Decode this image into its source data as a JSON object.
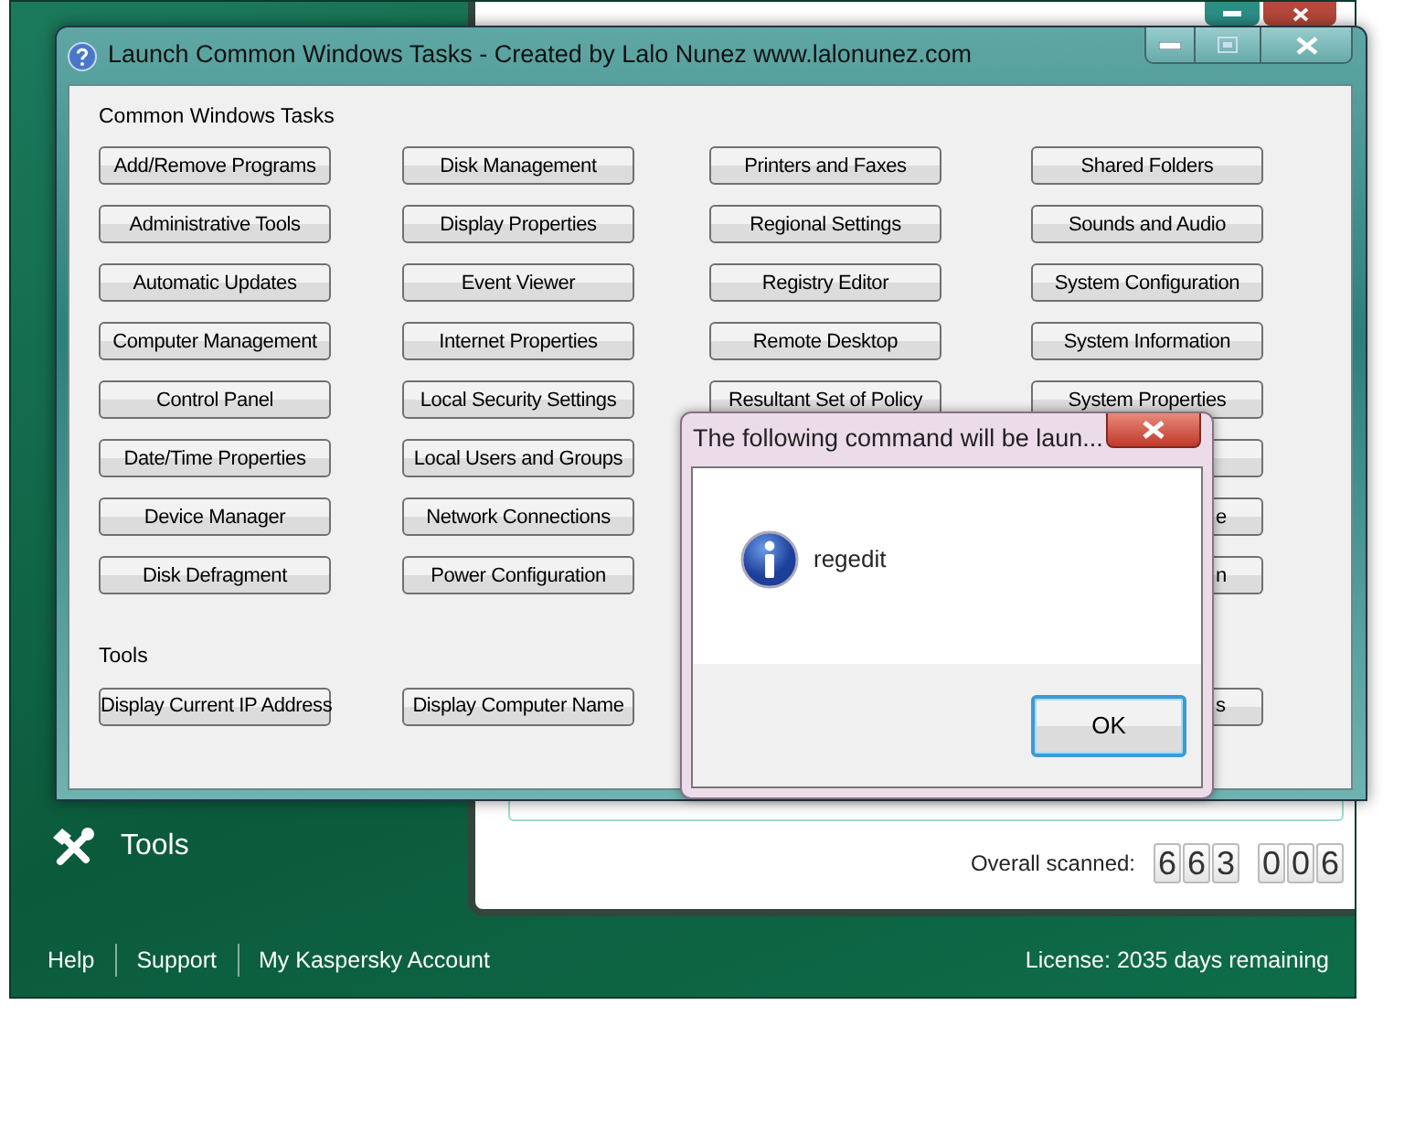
{
  "background_app": {
    "sidebar": {
      "items": [
        {
          "label": "Tools"
        }
      ]
    },
    "overall_scanned": {
      "label": "Overall scanned:",
      "groups": [
        [
          "6",
          "6",
          "3"
        ],
        [
          "0",
          "0",
          "6"
        ]
      ]
    },
    "footer": {
      "links": [
        "Help",
        "Support",
        "My Kaspersky Account"
      ],
      "license": "License: 2035 days remaining"
    }
  },
  "window": {
    "title": "Launch Common Windows Tasks - Created by Lalo Nunez www.lalonunez.com",
    "sections": [
      {
        "heading": "Common Windows Tasks",
        "columns": [
          [
            {
              "label": "Add/Remove Programs",
              "kind": "full"
            },
            {
              "label": "Administrative Tools",
              "kind": "full"
            },
            {
              "label": "Automatic Updates",
              "kind": "full"
            },
            {
              "label": "Computer Management",
              "kind": "full"
            },
            {
              "label": "Control Panel",
              "kind": "full"
            },
            {
              "label": "Date/Time Properties",
              "kind": "full"
            },
            {
              "label": "Device Manager",
              "kind": "full"
            },
            {
              "label": "Disk Defragment",
              "kind": "full"
            }
          ],
          [
            {
              "label": "Disk Management",
              "kind": "full"
            },
            {
              "label": "Display Properties",
              "kind": "full"
            },
            {
              "label": "Event Viewer",
              "kind": "full"
            },
            {
              "label": "Internet Properties",
              "kind": "full"
            },
            {
              "label": "Local Security Settings",
              "kind": "full"
            },
            {
              "label": "Local Users and Groups",
              "kind": "full"
            },
            {
              "label": "Network Connections",
              "kind": "full"
            },
            {
              "label": "Power Configuration",
              "kind": "full"
            }
          ],
          [
            {
              "label": "Printers and Faxes",
              "kind": "full"
            },
            {
              "label": "Regional Settings",
              "kind": "full"
            },
            {
              "label": "Registry Editor",
              "kind": "full"
            },
            {
              "label": "Remote Desktop",
              "kind": "full"
            },
            {
              "label": "Resultant Set of Policy",
              "kind": "full"
            }
          ],
          [
            {
              "label": "Shared Folders",
              "kind": "full"
            },
            {
              "label": "Sounds and Audio",
              "kind": "full"
            },
            {
              "label": "System Configuration",
              "kind": "full"
            },
            {
              "label": "System Information",
              "kind": "full"
            },
            {
              "label": "System Properties",
              "kind": "full"
            },
            {
              "kind": "edge"
            },
            {
              "label": "e",
              "kind": "partial"
            },
            {
              "label": "n",
              "kind": "partial"
            }
          ]
        ]
      },
      {
        "heading": "Tools",
        "columns": [
          [
            {
              "label": "Display Current IP Address",
              "kind": "full"
            }
          ],
          [
            {
              "label": "Display Computer Name",
              "kind": "full"
            }
          ],
          [
            {
              "kind": "hidden"
            }
          ],
          [
            {
              "label": "s",
              "kind": "partial"
            }
          ]
        ]
      }
    ]
  },
  "dialog": {
    "title": "The following command will be laun...",
    "message": "regedit",
    "buttons": [
      {
        "label": "OK",
        "selected": true
      }
    ]
  }
}
